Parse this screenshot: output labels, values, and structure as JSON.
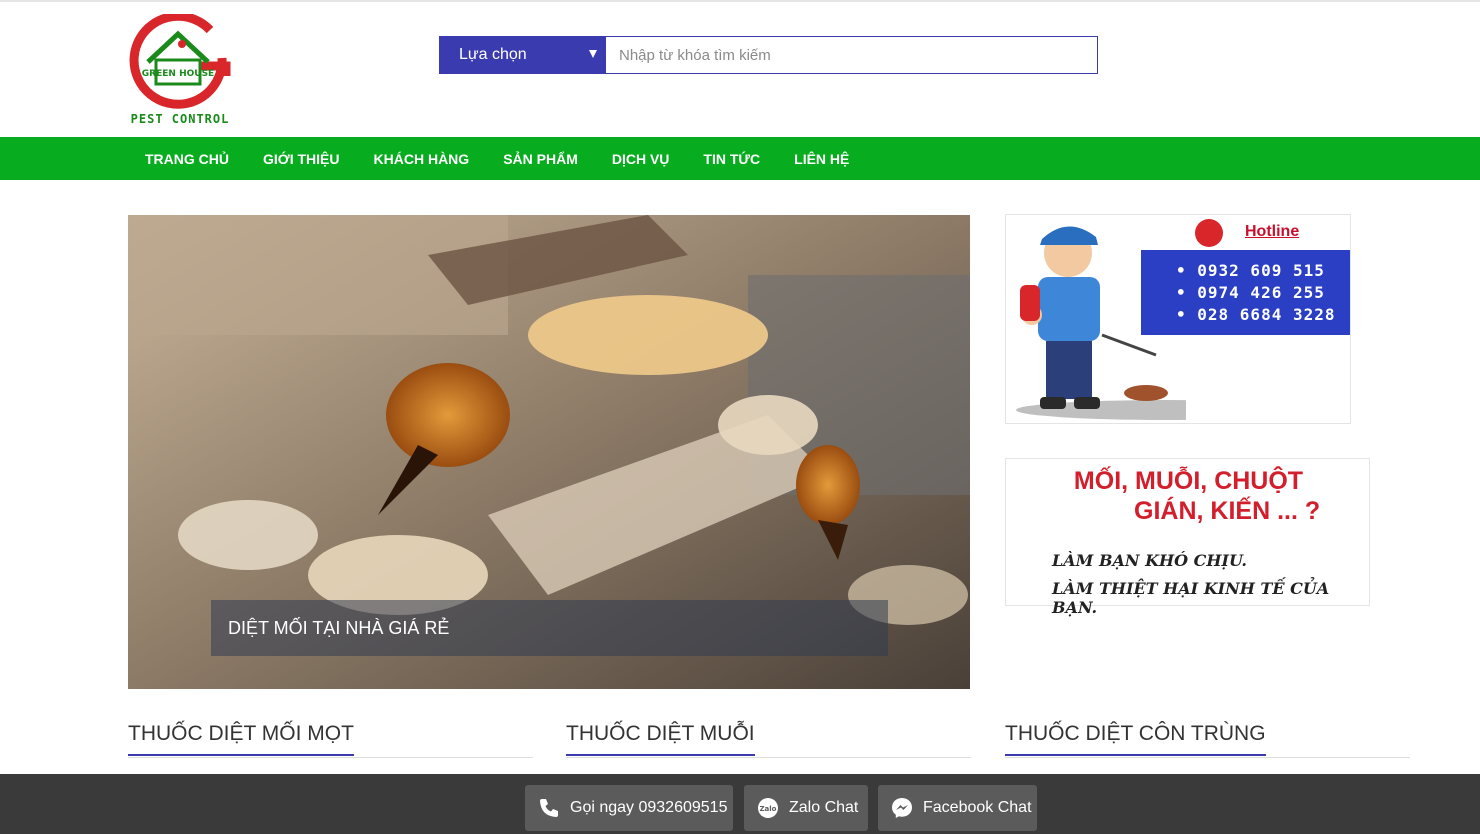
{
  "header": {
    "logo": {
      "name": "GREEN HOUSE",
      "subtitle": "PEST CONTROL",
      "icon": "house-g-logo-icon"
    },
    "search": {
      "select_label": "Lựa chọn",
      "placeholder": "Nhập từ khóa tìm kiếm",
      "value": ""
    }
  },
  "nav": {
    "items": [
      {
        "label": "TRANG CHỦ"
      },
      {
        "label": "GIỚI THIỆU"
      },
      {
        "label": "KHÁCH HÀNG"
      },
      {
        "label": "SẢN PHẨM"
      },
      {
        "label": "DỊCH VỤ"
      },
      {
        "label": "TIN TỨC"
      },
      {
        "label": "LIÊN HỆ"
      }
    ]
  },
  "slider": {
    "caption": "DIỆT MỐI TẠI NHÀ GIÁ RẺ"
  },
  "sidebar": {
    "hotline": {
      "label": "Hotline",
      "phones": [
        "• 0932 609 515",
        "• 0974 426 255",
        "• 028 6684 3228"
      ]
    },
    "promo": {
      "line1": "MỐI, MUỖI, CHUỘT",
      "line2": "GIÁN, KIẾN ... ?",
      "line3": "LÀM BẠN KHÓ CHỊU.",
      "line4": "LÀM THIỆT HẠI KINH TẾ CỦA BẠN."
    }
  },
  "sections": [
    {
      "title": "THUỐC DIỆT MỐI MỌT"
    },
    {
      "title": "THUỐC DIỆT MUỖI"
    },
    {
      "title": "THUỐC DIỆT CÔN TRÙNG"
    }
  ],
  "bottom_bar": {
    "call": {
      "label": "Gọi ngay 0932609515",
      "icon": "phone-icon"
    },
    "zalo": {
      "label": "Zalo Chat",
      "icon": "zalo-icon"
    },
    "facebook": {
      "label": "Facebook Chat",
      "icon": "messenger-icon"
    }
  },
  "colors": {
    "nav": "#08ad1f",
    "accent": "#3b3bb0",
    "bottom_bar": "#3a3a3a",
    "promo_red": "#d31f2c"
  }
}
